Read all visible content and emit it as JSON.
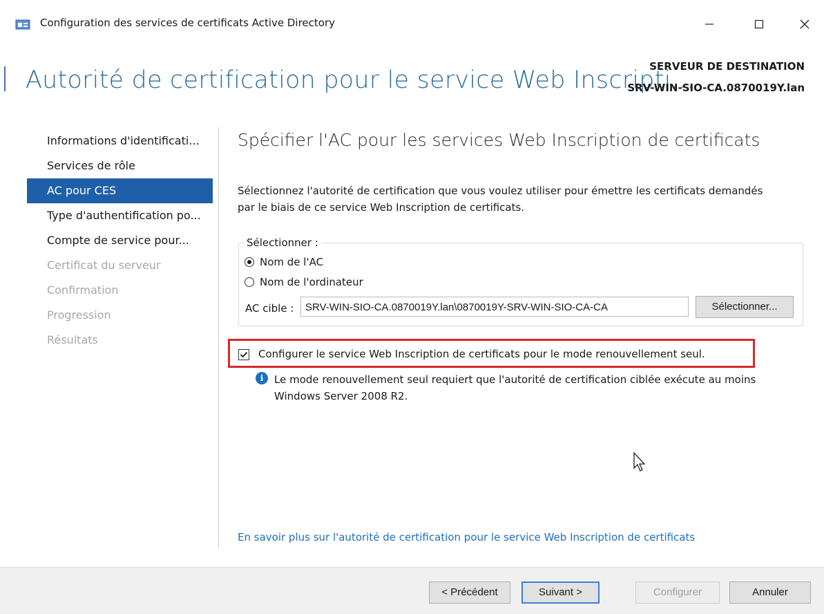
{
  "window": {
    "title": "Configuration des services de certificats Active Directory",
    "icon": "server-config-icon",
    "controls": {
      "minimize": "minimize-icon",
      "maximize": "maximize-icon",
      "close": "close-icon"
    }
  },
  "header": {
    "heading": "Autorité de certification pour le service Web Inscripti...",
    "destination_label": "SERVEUR DE DESTINATION",
    "destination_server": "SRV-WIN-SIO-CA.0870019Y.lan"
  },
  "nav": {
    "items": [
      {
        "label": "Informations d'identificati...",
        "state": "enabled"
      },
      {
        "label": "Services de rôle",
        "state": "enabled"
      },
      {
        "label": "AC pour CES",
        "state": "active"
      },
      {
        "label": "Type d'authentification po...",
        "state": "enabled"
      },
      {
        "label": "Compte de service pour...",
        "state": "enabled"
      },
      {
        "label": "Certificat du serveur",
        "state": "disabled"
      },
      {
        "label": "Confirmation",
        "state": "disabled"
      },
      {
        "label": "Progression",
        "state": "disabled"
      },
      {
        "label": "Résultats",
        "state": "disabled"
      }
    ]
  },
  "content": {
    "section_title": "Spécifier l'AC pour les services Web Inscription de certificats",
    "description": "Sélectionnez l'autorité de certification que vous voulez utiliser pour émettre les certificats demandés par le biais de ce service Web Inscription de certificats.",
    "select_group": {
      "legend": "Sélectionner :",
      "option_ca_name": "Nom de l'AC",
      "option_computer_name": "Nom de l'ordinateur",
      "selected": "option_ca_name",
      "target_label": "AC cible :",
      "target_value": "SRV-WIN-SIO-CA.0870019Y.lan\\0870019Y-SRV-WIN-SIO-CA-CA",
      "select_button": "Sélectionner..."
    },
    "renewal_checkbox": {
      "label": "Configurer le service Web Inscription de certificats pour le mode renouvellement seul.",
      "checked": true
    },
    "info": {
      "icon": "info-icon",
      "text": "Le mode renouvellement seul requiert que l'autorité de certification ciblée exécute au moins Windows Server 2008 R2."
    },
    "learn_more_link": "En savoir plus sur l'autorité de certification pour le service Web Inscription de certificats"
  },
  "footer": {
    "previous": "< Précédent",
    "next": "Suivant >",
    "configure": "Configurer",
    "cancel": "Annuler"
  },
  "colors": {
    "accent": "#1f5fa7",
    "heading": "#2d6e9b",
    "link": "#1f6fbf",
    "highlight": "#d9272e"
  }
}
